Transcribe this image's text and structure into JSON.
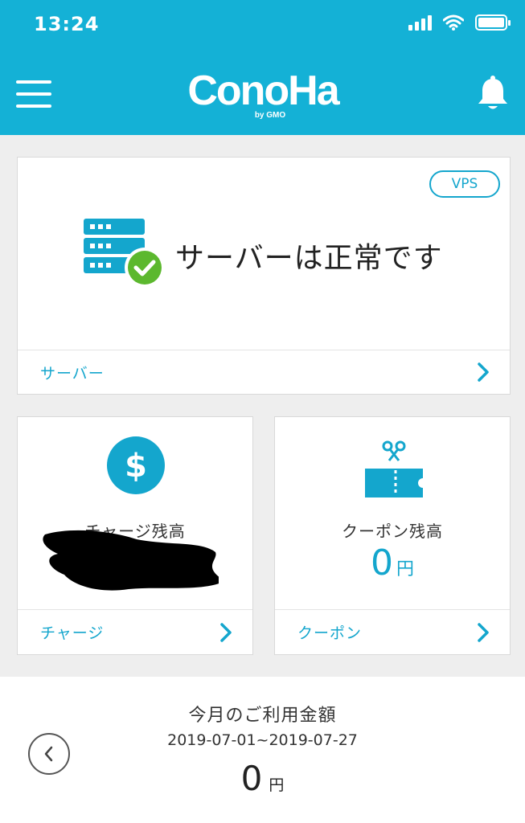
{
  "status_bar": {
    "time": "13:24"
  },
  "header": {
    "logo_text": "ConoHa",
    "logo_sub": "by GMO"
  },
  "server_card": {
    "badge": "VPS",
    "status": "サーバーは正常です",
    "footer_label": "サーバー"
  },
  "charge_card": {
    "title": "チャージ残高",
    "footer_label": "チャージ"
  },
  "coupon_card": {
    "title": "クーポン残高",
    "amount": "0",
    "unit": "円",
    "footer_label": "クーポン"
  },
  "usage": {
    "title": "今月のご利用金額",
    "period": "2019-07-01~2019-07-27",
    "amount": "0",
    "unit": "円"
  },
  "colors": {
    "brand": "#14b1d6",
    "accent": "#14a6cd",
    "success": "#5cb82e"
  },
  "icons": {
    "menu": "hamburger-icon",
    "bell": "bell-icon",
    "server": "server-icon",
    "check": "check-icon",
    "dollar": "dollar-icon",
    "coupon": "coupon-icon",
    "chevron": "chevron-right-icon",
    "prev": "chevron-left-icon"
  }
}
